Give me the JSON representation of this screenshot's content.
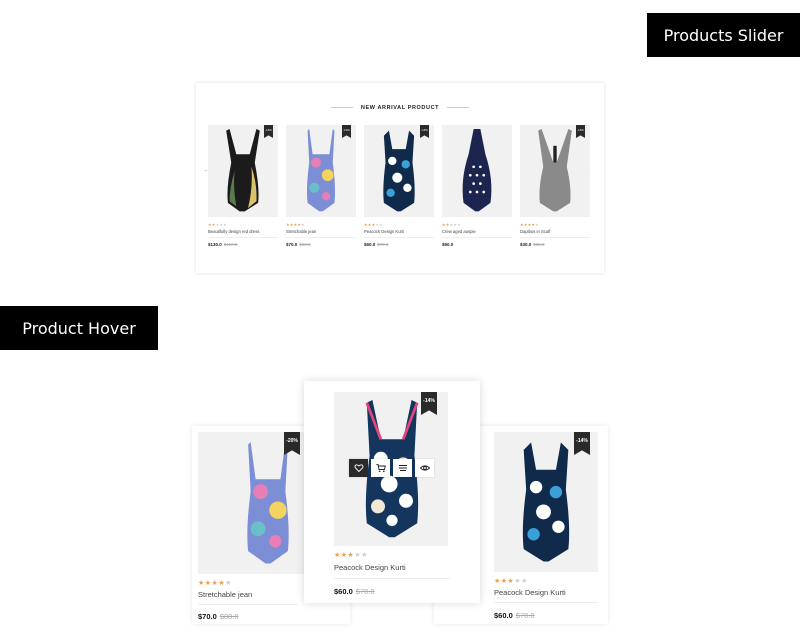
{
  "labels": {
    "slider_title": "Products Slider",
    "hover_title": "Product Hover"
  },
  "slider": {
    "heading": "NEW ARRIVAL PRODUCT",
    "prev_arrow": "←",
    "next_arrow": "→",
    "products": [
      {
        "name": "Beautifully design red dress",
        "badge": "-14%",
        "price": "$130.0",
        "old_price": "$150.0",
        "rating": 2
      },
      {
        "name": "Stretchable jean",
        "badge": "-14%",
        "price": "$70.0",
        "old_price": "$88.0",
        "rating": 4
      },
      {
        "name": "Peacock Design Kurti",
        "badge": "-14%",
        "price": "$60.0",
        "old_price": "$70.0",
        "rating": 3
      },
      {
        "name": "Crew aged auspie",
        "badge": "",
        "price": "$60.0",
        "old_price": "",
        "rating": 2
      },
      {
        "name": "Dapibus in Scalf",
        "badge": "-14%",
        "price": "$30.0",
        "old_price": "$35.0",
        "rating": 4
      }
    ]
  },
  "hover": {
    "left": {
      "name": "Stretchable jean",
      "badge": "-20%",
      "price": "$70.0",
      "old_price": "$88.0",
      "rating": 4
    },
    "center": {
      "name": "Peacock Design Kurti",
      "badge": "-14%",
      "price": "$60.0",
      "old_price": "$70.0",
      "rating": 3
    },
    "right": {
      "name": "Peacock Design Kurti",
      "badge": "-14%",
      "price": "$60.0",
      "old_price": "$70.0",
      "rating": 3
    },
    "actions": [
      "heart-icon",
      "cart-icon",
      "compare-icon",
      "quickview-icon"
    ]
  },
  "colors": {
    "label_bg": "#000000",
    "ribbon": "#2a2a2a",
    "star_on": "#e8a04d",
    "star_off": "#cfcfcf"
  }
}
